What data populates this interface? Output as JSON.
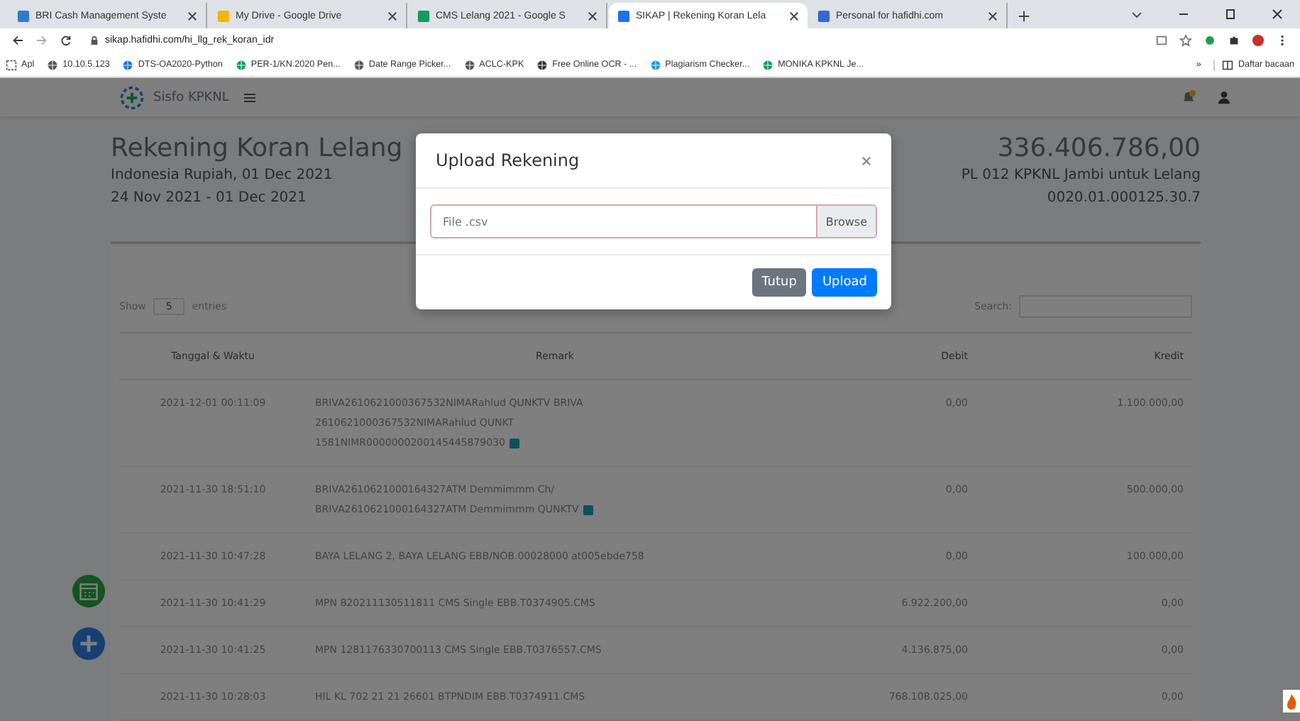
{
  "browser": {
    "tabs": [
      {
        "title": "BRI Cash Management Syste",
        "selected": false
      },
      {
        "title": "My Drive - Google Drive",
        "selected": false
      },
      {
        "title": "CMS Lelang 2021 - Google S",
        "selected": false
      },
      {
        "title": "SIKAP | Rekening Koran Lela",
        "selected": true
      },
      {
        "title": "Personal for hafidhi.com",
        "selected": false
      }
    ],
    "address": "sikap.hafidhi.com/hi_llg_rek_koran_idr",
    "bookmarks": [
      {
        "label": "Apl"
      },
      {
        "label": "10.10.5.123"
      },
      {
        "label": "DTS-OA2020-Python"
      },
      {
        "label": "PER-1/KN.2020 Pen..."
      },
      {
        "label": "Date Range Picker..."
      },
      {
        "label": "ACLC-KPK"
      },
      {
        "label": "Free Online OCR - ..."
      },
      {
        "label": "Plagiarism Checker..."
      },
      {
        "label": "MONIKA KPKNL Je..."
      }
    ],
    "bookmarks_more": "»",
    "reading_list": "Daftar bacaan"
  },
  "app": {
    "brand": "Sisfo KPKNL"
  },
  "header": {
    "title": "Rekening Koran Lelang",
    "currency_date": "Indonesia Rupiah, 01 Dec 2021",
    "period": "24 Nov 2021 - 01 Dec 2021",
    "balance": "336.406.786,00",
    "account_name": "PL 012 KPKNL Jambi untuk Lelang",
    "account_number": "0020.01.000125.30.7"
  },
  "table": {
    "show_label": "Show",
    "entries_count": "5",
    "entries_label": "entries",
    "search_label": "Search:",
    "columns": [
      "Tanggal & Waktu",
      "Remark",
      "Debit",
      "Kredit"
    ],
    "rows": [
      {
        "date": "2021-12-01 00:11:09",
        "remark": [
          "BRIVA2610621000367532NIMARahlud QUNKTV BRIVA",
          "2610621000367532NIMARahlud QUNKT",
          "1581NIMR0000000200145445879030"
        ],
        "debit": "0,00",
        "kredit": "1.100.000,00",
        "attachment": true
      },
      {
        "date": "2021-11-30 18:51:10",
        "remark": [
          "BRIVA2610621000164327ATM Demmimmm Ch/",
          "BRIVA2610621000164327ATM Demmimmm QUNKTV"
        ],
        "debit": "0,00",
        "kredit": "500.000,00",
        "attachment": true
      },
      {
        "date": "2021-11-30 10:47:28",
        "remark": [
          "BAYA LELANG 2, BAYA LELANG EBB/NOB.00028000 at005ebde758"
        ],
        "debit": "0,00",
        "kredit": "100.000,00",
        "attachment": false
      },
      {
        "date": "2021-11-30 10:41:29",
        "remark": [
          "MPN 820211130511811 CMS Single EBB.T0374905.CMS"
        ],
        "debit": "6.922.200,00",
        "kredit": "0,00",
        "attachment": false
      },
      {
        "date": "2021-11-30 10:41:25",
        "remark": [
          "MPN 1281176330700113 CMS Single EBB.T0376557.CMS"
        ],
        "debit": "4.136.875,00",
        "kredit": "0,00",
        "attachment": false
      },
      {
        "date": "2021-11-30 10:28:03",
        "remark": [
          "HIL KL 702 21 21 26601 BTPNDIM EBB.T0374911.CMS"
        ],
        "debit": "768.108.025,00",
        "kredit": "0,00",
        "attachment": false
      }
    ]
  },
  "modal": {
    "title": "Upload Rekening",
    "placeholder": "File .csv",
    "browse": "Browse",
    "buttons": [
      {
        "label": "Tutup",
        "kind": "secondary"
      },
      {
        "label": "Upload",
        "kind": "primary"
      }
    ]
  }
}
